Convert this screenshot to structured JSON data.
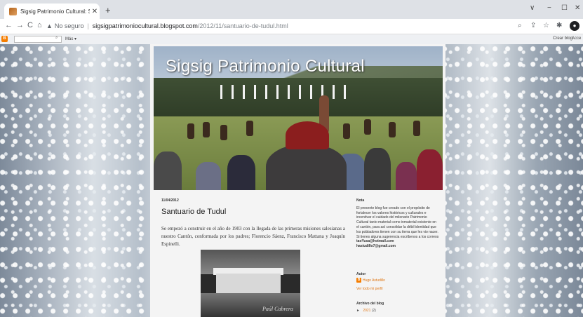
{
  "browser": {
    "tab_title": "Sigsig Patrimonio Cultural: Santu",
    "close": "✕",
    "new_tab": "+",
    "controls": {
      "chevron": "∨",
      "minimize": "−",
      "restore": "☐",
      "close": "✕"
    },
    "nav": {
      "back": "←",
      "forward": "→",
      "reload": "C",
      "home": "⌂"
    },
    "security_icon": "▲",
    "security_text": "No seguro",
    "separator": "|",
    "url_host": "sigsigpatrimoniocultural.blogspot.com",
    "url_path": "/2012/11/santuario-de-tudul.html",
    "toolbar_icons": {
      "zoom": "⌕",
      "share": "⇪",
      "star": "☆",
      "extensions": "✱",
      "profile": "●"
    }
  },
  "blogger_bar": {
    "logo": "B",
    "search_icon": "⌕",
    "more": "Más ▾",
    "create": "Crear blog",
    "access": "Acce"
  },
  "blog": {
    "title": "Sigsig Patrimonio Cultural"
  },
  "post": {
    "date": "11/04/2012",
    "title": "Santuario de Tudul",
    "body": "Se empezó a construir en el año de 1903 con la llegada de las primeras misiones salesianas a nuestro Cantón, conformada por los padres; Florencio Sáenz, Francisco Mattana y Joaquín Espinelli.",
    "photo_signature": "Paúl Cabrera"
  },
  "sidebar": {
    "nota_heading": "Nota",
    "nota_text": "El presente blog fue creado con el propósito de fortalecer los valores históricos y culturales e incentivar el cuidado del milenario Patrimonio Cultural tanto material como inmaterial existente en el cantón, para así consolidar la débil identidad que los pobladores tienen con su tierra que les vio nacer.",
    "nota_text2": "Si tienes alguna sugerencia escríbenos a los correos",
    "email1": "taoYusa@hotmail.com",
    "email2": "hastudillo7@gmail.com",
    "autor_heading": "Autor",
    "autor_icon": "B",
    "autor_name": "Hugo Astudillo",
    "profile_link": "Ver todo mi perfil",
    "archivo_heading": "Archivo del blog",
    "archivo_toggle": "►",
    "archivo_year": "2021",
    "archivo_count": "(2)"
  }
}
